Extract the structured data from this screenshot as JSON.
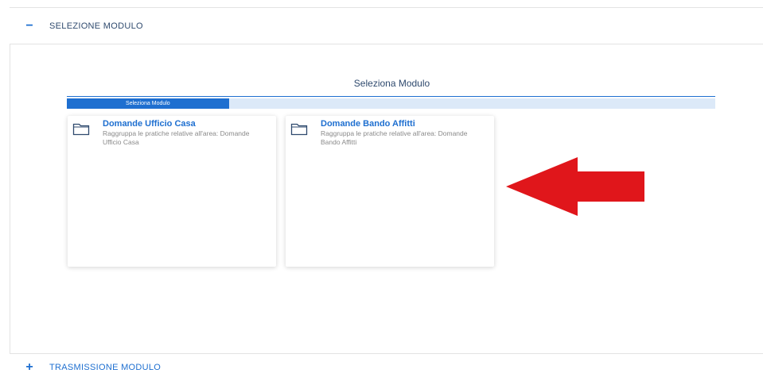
{
  "sections": [
    {
      "toggle": "−",
      "title": "SELEZIONE MODULO"
    },
    {
      "toggle": "+",
      "title": "TRASMISSIONE MODULO"
    }
  ],
  "wizard": {
    "title": "Seleziona Modulo",
    "step_label": "Seleziona Modulo",
    "progress": 0.25
  },
  "cards": [
    {
      "icon": "folder-icon",
      "title": "Domande Ufficio Casa",
      "description": "Raggruppa le pratiche relative all'area: Domande Ufficio Casa"
    },
    {
      "icon": "folder-icon",
      "title": "Domande Bando Affitti",
      "description": "Raggruppa le pratiche relative all'area: Domande Bando Affitti"
    }
  ],
  "colors": {
    "accent": "#1e6fd0",
    "arrow": "#e0161b"
  }
}
